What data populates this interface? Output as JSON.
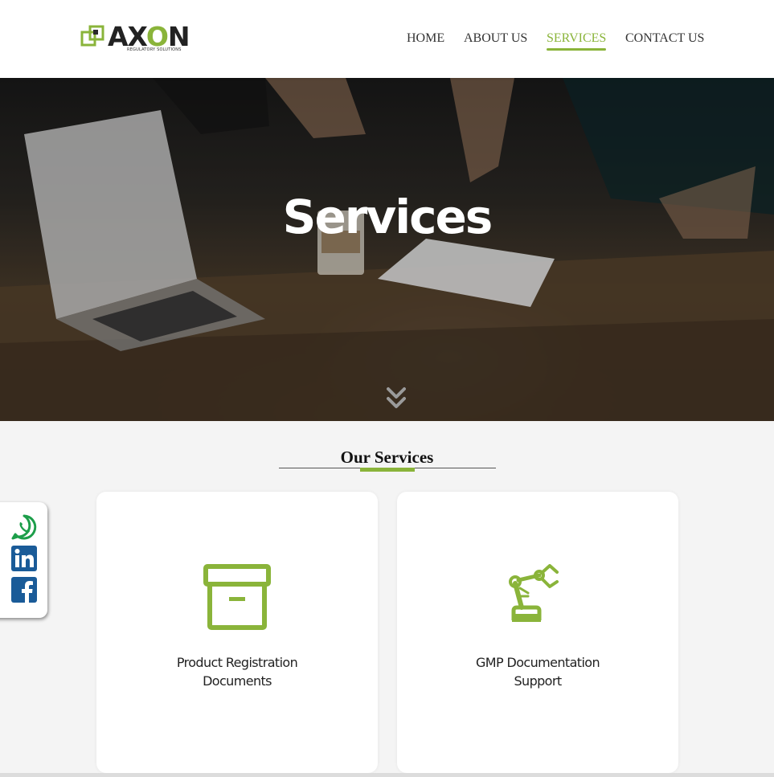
{
  "brand": {
    "name_part1": "AX",
    "name_o": "O",
    "name_part2": "N",
    "tagline": "REGULATORY SOLUTIONS",
    "accent_color": "#8ab43a"
  },
  "nav": {
    "items": [
      {
        "label": "HOME"
      },
      {
        "label": "ABOUT US"
      },
      {
        "label": "SERVICES",
        "active": true
      },
      {
        "label": "CONTACT US"
      }
    ]
  },
  "hero": {
    "title": "Services",
    "scroll_icon": "double-chevron-down-icon"
  },
  "section": {
    "title": "Our Services"
  },
  "services": [
    {
      "line1": "Product Registration",
      "line2": "Documents",
      "icon": "archive-box-icon"
    },
    {
      "line1": "GMP Documentation",
      "line2": "Support",
      "icon": "robot-arm-icon"
    }
  ],
  "social": [
    {
      "icon": "whatsapp-icon",
      "color": "#1d9e4a"
    },
    {
      "icon": "linkedin-icon",
      "color": "#1a5b98"
    },
    {
      "icon": "facebook-icon",
      "color": "#1a5b98"
    }
  ]
}
